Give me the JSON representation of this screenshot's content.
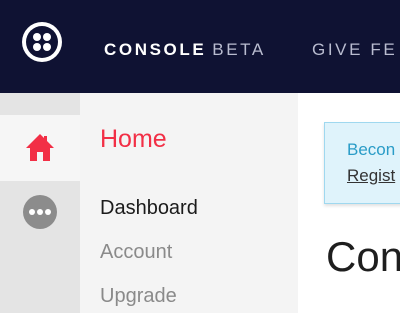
{
  "topbar": {
    "logo_icon": "twilio-logo-icon",
    "console_label": "CONSOLE",
    "beta_label": "BETA",
    "feedback_label": "GIVE FE",
    "background": "#0f1233"
  },
  "rail": {
    "items": [
      {
        "icon": "home-icon",
        "active": true,
        "color": "#f22f46"
      },
      {
        "icon": "more-icon",
        "active": false,
        "color": "#8c8c8c"
      }
    ]
  },
  "subnav": {
    "title": "Home",
    "links": [
      "Dashboard",
      "Account",
      "Upgrade"
    ]
  },
  "main": {
    "banner": {
      "title": "Becon",
      "link": "Regist"
    },
    "heading": "Con"
  }
}
